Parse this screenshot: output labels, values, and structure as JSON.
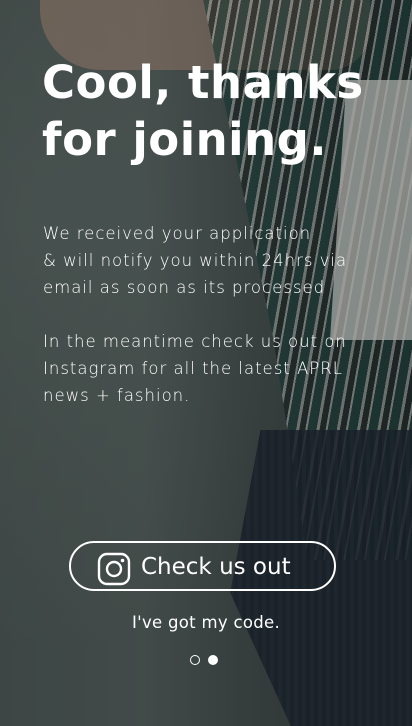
{
  "title": {
    "line1": "Cool, thanks",
    "line2": "for joining."
  },
  "message": {
    "para1": [
      "We received your application",
      "& will notify you within 24hrs via",
      "email as soon as its processed"
    ],
    "para2": [
      "In the meantime check us out on",
      "Instagram for all the latest APRL",
      "news + fashion."
    ]
  },
  "cta": {
    "label": "Check us out",
    "icon": "instagram-icon"
  },
  "secondary_link": "I've got my code.",
  "pagination": {
    "total": 2,
    "active": 2
  },
  "colors": {
    "text": "#ffffff",
    "shirt_accent": "#16463f"
  }
}
